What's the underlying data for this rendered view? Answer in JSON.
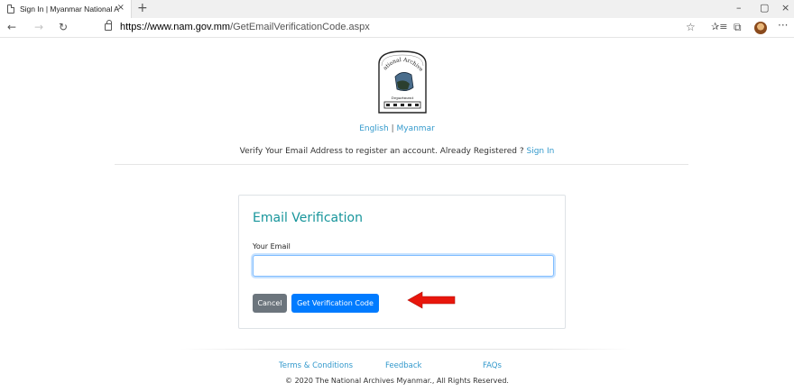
{
  "browser": {
    "tab_title": "Sign In | Myanmar National Archi",
    "tab_close": "×",
    "new_tab": "+",
    "window_controls": {
      "minimize": "–",
      "maximize": "▢",
      "close": "×"
    },
    "nav": {
      "back": "←",
      "forward": "→",
      "refresh": "↻"
    },
    "url_host": "https://www.nam.gov.mm",
    "url_path": "/GetEmailVerificationCode.aspx",
    "toolbar_icons": [
      "favorite-star-icon",
      "favorites-list-icon",
      "collections-icon",
      "profile-avatar",
      "more-icon"
    ],
    "toolbar_glyphs": {
      "favorite": "☆",
      "favorites": "⭐",
      "collections": "⧉",
      "more": "···"
    }
  },
  "logo": {
    "arc_text": "National Archives",
    "dept_text": "Department"
  },
  "language": {
    "english": "English",
    "separator": "|",
    "myanmar": "Myanmar"
  },
  "verify_line": {
    "text": "Verify Your Email Address to register an account. Already Registered ? ",
    "sign_in": "Sign In"
  },
  "card": {
    "title": "Email Verification",
    "email_label": "Your Email",
    "email_value": "",
    "cancel_label": "Cancel",
    "submit_label": "Get Verification Code"
  },
  "footer": {
    "terms": "Terms & Conditions",
    "feedback": "Feedback",
    "faqs": "FAQs",
    "copyright": "© 2020 The National Archives Myanmar., All Rights Reserved."
  },
  "colors": {
    "accent_teal": "#17959b",
    "link_blue": "#3399cc",
    "primary_blue": "#007bff",
    "secondary_gray": "#6c757d",
    "annotation_red": "#e8160c"
  }
}
